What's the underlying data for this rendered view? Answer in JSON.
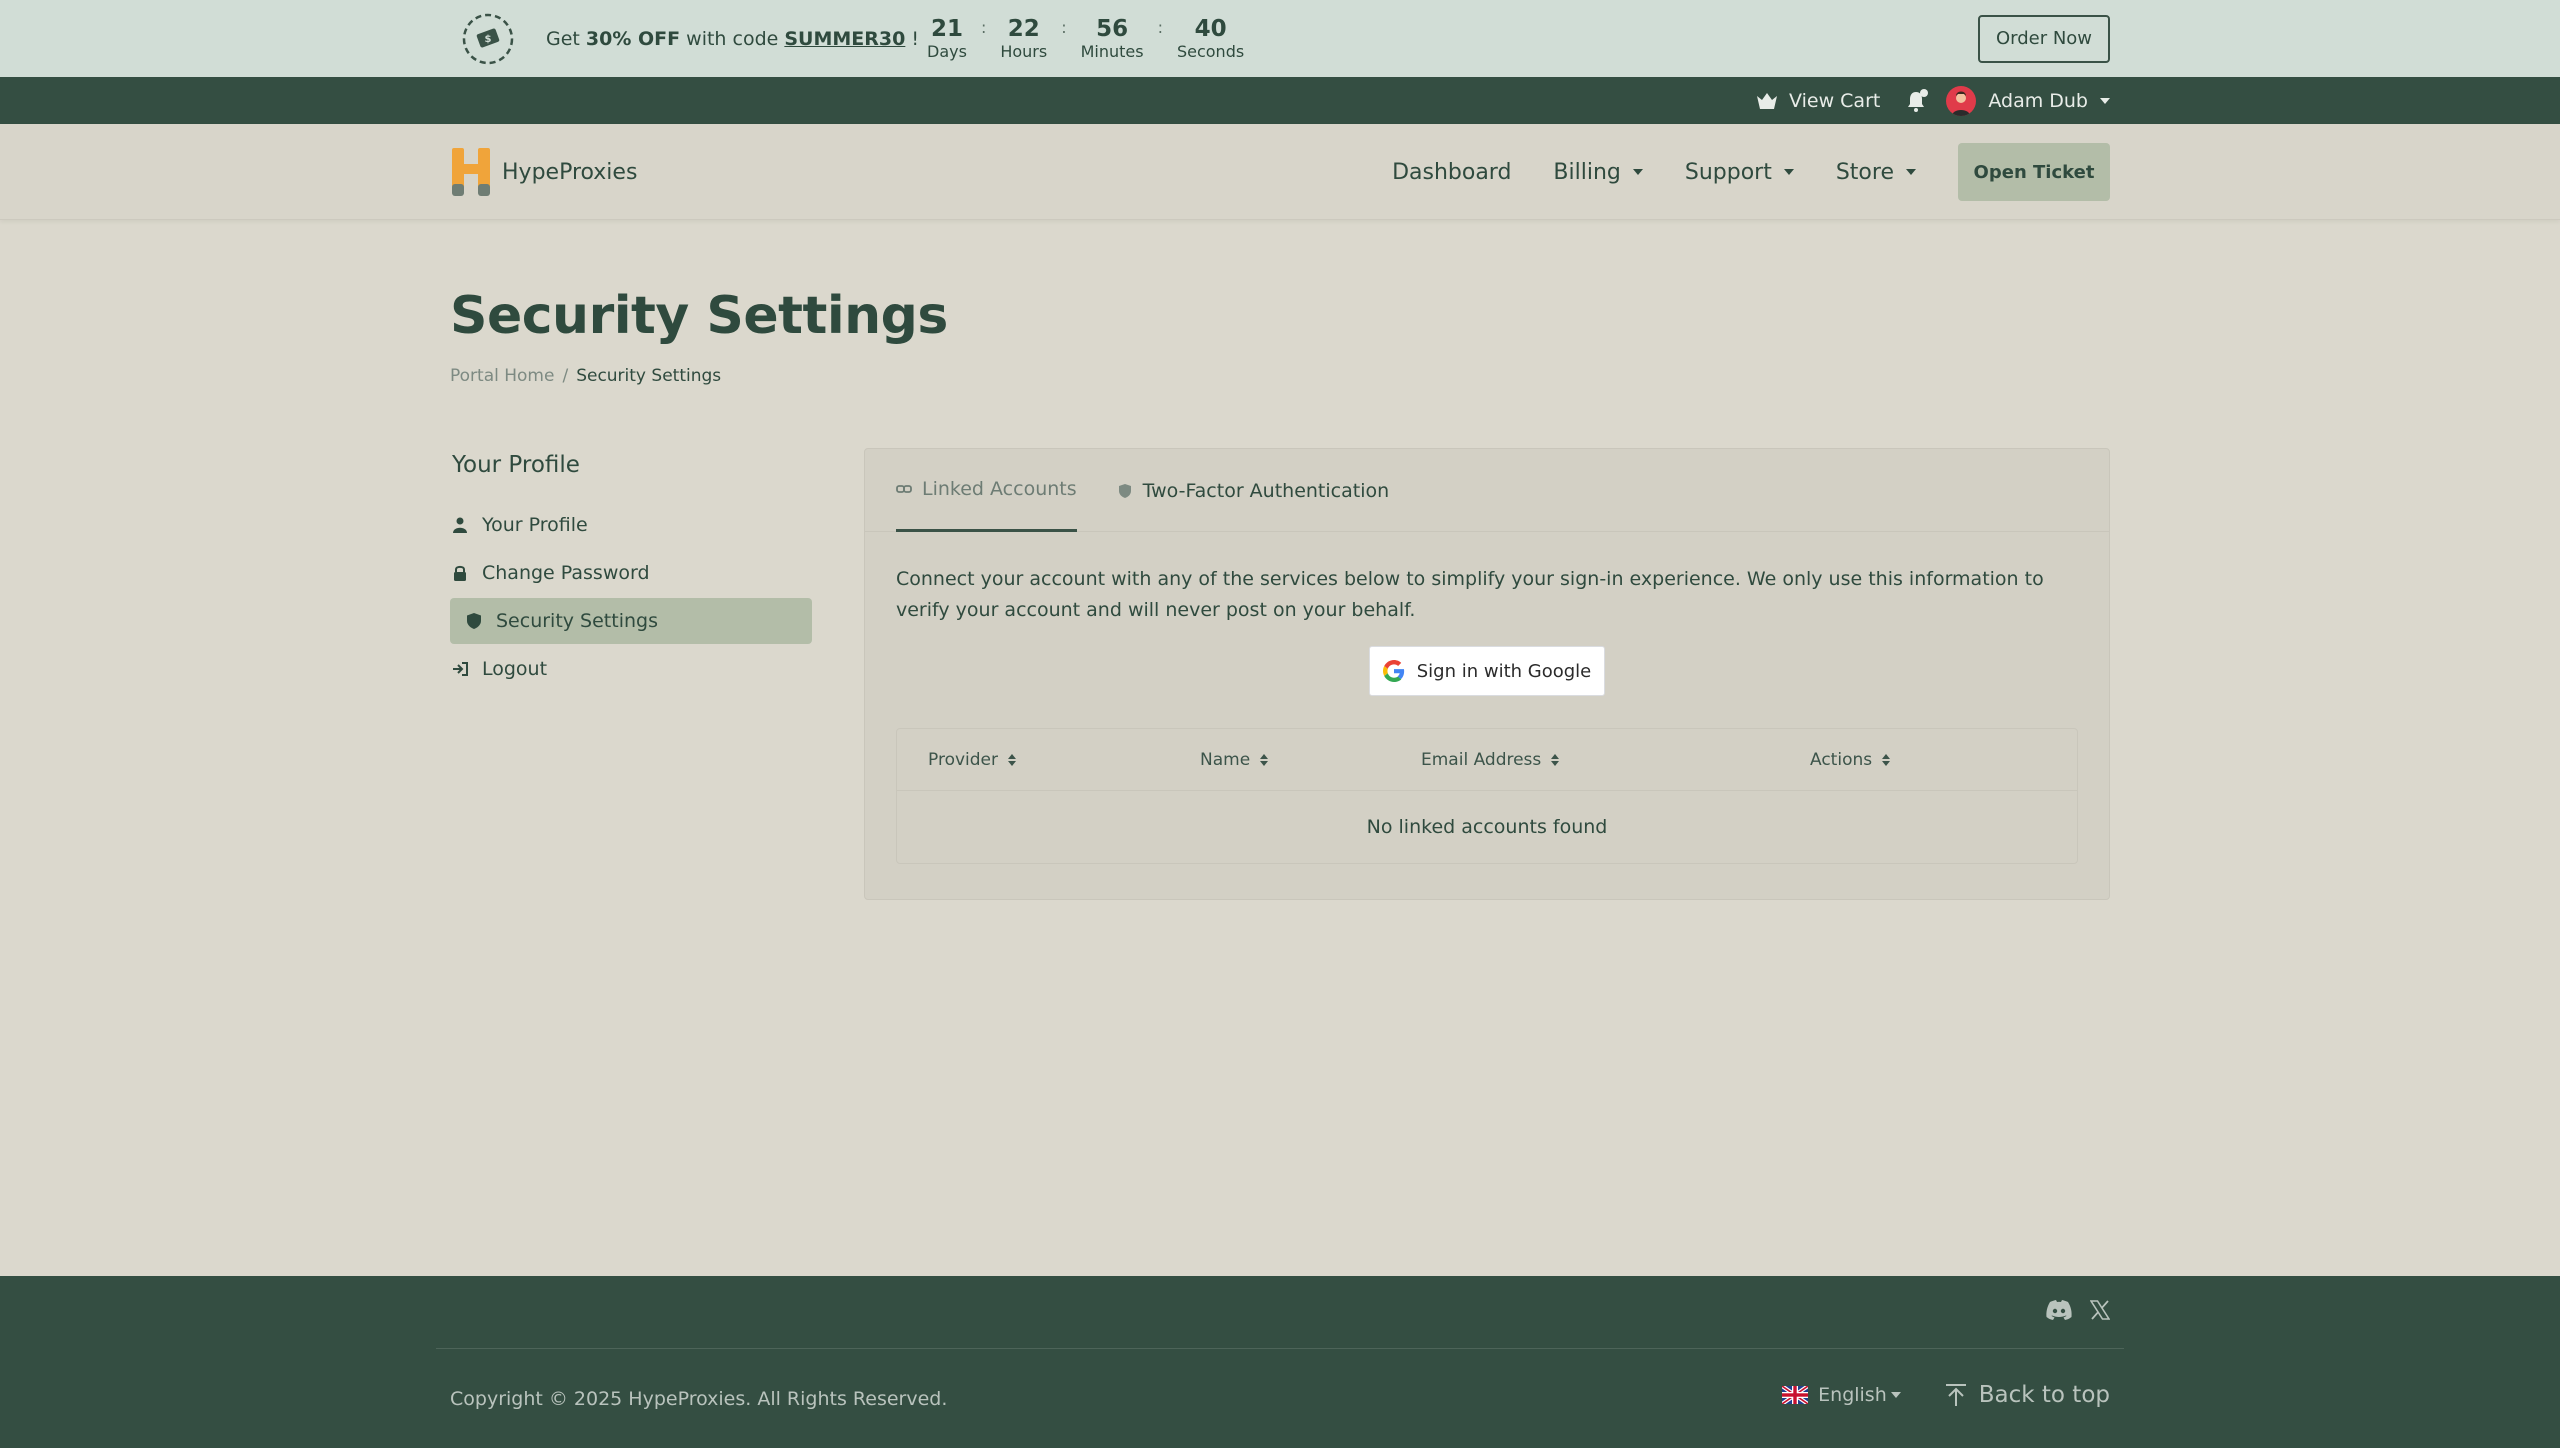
{
  "promo": {
    "text_before": "Get ",
    "discount": "30% OFF",
    "text_middle": " with code ",
    "code": "SUMMER30",
    "text_after": " !",
    "countdown": [
      {
        "value": "21",
        "label": "Days"
      },
      {
        "value": "22",
        "label": "Hours"
      },
      {
        "value": "56",
        "label": "Minutes"
      },
      {
        "value": "40",
        "label": "Seconds"
      }
    ],
    "order_button": "Order Now"
  },
  "topbar": {
    "cart_label": "View Cart",
    "user_name": "Adam Dub"
  },
  "header": {
    "brand": "HypeProxies",
    "nav": {
      "dashboard": "Dashboard",
      "billing": "Billing",
      "support": "Support",
      "store": "Store"
    },
    "open_ticket": "Open Ticket"
  },
  "page": {
    "title": "Security Settings",
    "breadcrumb": {
      "home": "Portal Home",
      "separator": "/",
      "current": "Security Settings"
    }
  },
  "sidebar": {
    "title": "Your Profile",
    "items": [
      {
        "label": "Your Profile",
        "icon": "user-icon"
      },
      {
        "label": "Change Password",
        "icon": "lock-icon"
      },
      {
        "label": "Security Settings",
        "icon": "shield-icon",
        "active": true
      },
      {
        "label": "Logout",
        "icon": "logout-icon"
      }
    ]
  },
  "panel": {
    "tabs": [
      {
        "label": "Linked Accounts",
        "icon": "link-icon",
        "active": true
      },
      {
        "label": "Two-Factor Authentication",
        "icon": "shield-icon",
        "active": false
      }
    ],
    "description": "Connect your account with any of the services below to simplify your sign-in experience. We only use this information to verify your account and will never post on your behalf.",
    "google_button": "Sign in with Google",
    "table": {
      "columns": [
        "Provider",
        "Name",
        "Email Address",
        "Actions"
      ],
      "empty_message": "No linked accounts found"
    }
  },
  "footer": {
    "copyright": "Copyright © 2025 HypeProxies. All Rights Reserved.",
    "language": "English",
    "back_to_top": "Back to top"
  },
  "colors": {
    "background": "#dbd8cd",
    "dark_green": "#344e42",
    "accent": "#b3bda8",
    "promo_bg": "#d1ddd6"
  }
}
